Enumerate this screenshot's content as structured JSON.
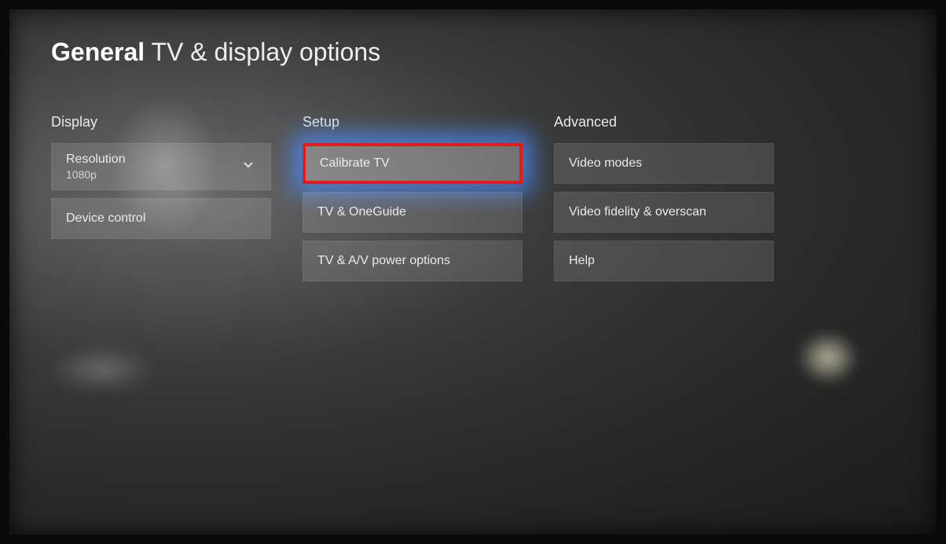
{
  "header": {
    "breadcrumb_bold": "General",
    "breadcrumb_rest": "TV & display options"
  },
  "columns": {
    "display": {
      "header": "Display",
      "items": [
        {
          "label": "Resolution",
          "value": "1080p",
          "type": "dropdown"
        },
        {
          "label": "Device control",
          "type": "button"
        }
      ]
    },
    "setup": {
      "header": "Setup",
      "items": [
        {
          "label": "Calibrate TV",
          "selected": true,
          "annotated": true
        },
        {
          "label": "TV & OneGuide"
        },
        {
          "label": "TV & A/V power options"
        }
      ]
    },
    "advanced": {
      "header": "Advanced",
      "items": [
        {
          "label": "Video modes"
        },
        {
          "label": "Video fidelity & overscan"
        },
        {
          "label": "Help"
        }
      ]
    }
  },
  "annotation": {
    "highlight_color": "#e21b1b",
    "glow_color": "#4a8cff"
  }
}
